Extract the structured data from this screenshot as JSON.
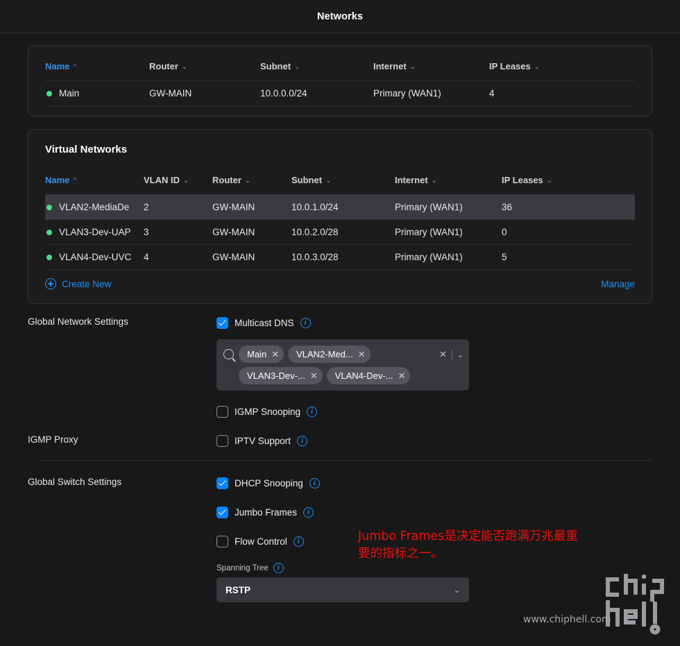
{
  "header": {
    "title": "Networks"
  },
  "networks_card": {
    "columns": [
      {
        "label": "Name",
        "sorted": true,
        "icon": "chevron-up-icon"
      },
      {
        "label": "Router",
        "sorted": false,
        "icon": "chevron-down-icon"
      },
      {
        "label": "Subnet",
        "sorted": false,
        "icon": "chevron-down-icon"
      },
      {
        "label": "Internet",
        "sorted": false,
        "icon": "chevron-down-icon"
      },
      {
        "label": "IP Leases",
        "sorted": false,
        "icon": "chevron-down-icon"
      }
    ],
    "rows": [
      {
        "status": "online",
        "name": "Main",
        "router": "GW-MAIN",
        "subnet": "10.0.0.0/24",
        "internet": "Primary (WAN1)",
        "leases": "4"
      }
    ]
  },
  "vlans_card": {
    "title": "Virtual Networks",
    "columns": [
      {
        "label": "Name",
        "sorted": true,
        "icon": "chevron-up-icon"
      },
      {
        "label": "VLAN ID",
        "sorted": false,
        "icon": "chevron-down-icon"
      },
      {
        "label": "Router",
        "sorted": false,
        "icon": "chevron-down-icon"
      },
      {
        "label": "Subnet",
        "sorted": false,
        "icon": "chevron-down-icon"
      },
      {
        "label": "Internet",
        "sorted": false,
        "icon": "chevron-down-icon"
      },
      {
        "label": "IP Leases",
        "sorted": false,
        "icon": "chevron-down-icon"
      }
    ],
    "rows": [
      {
        "status": "online",
        "name": "VLAN2-MediaDe",
        "vlan_id": "2",
        "router": "GW-MAIN",
        "subnet": "10.0.1.0/24",
        "internet": "Primary (WAN1)",
        "leases": "36",
        "selected": true
      },
      {
        "status": "online",
        "name": "VLAN3-Dev-UAP",
        "vlan_id": "3",
        "router": "GW-MAIN",
        "subnet": "10.0.2.0/28",
        "internet": "Primary (WAN1)",
        "leases": "0",
        "selected": false
      },
      {
        "status": "online",
        "name": "VLAN4-Dev-UVC",
        "vlan_id": "4",
        "router": "GW-MAIN",
        "subnet": "10.0.3.0/28",
        "internet": "Primary (WAN1)",
        "leases": "5",
        "selected": false
      }
    ],
    "create_new_label": "Create New",
    "manage_label": "Manage"
  },
  "settings": {
    "global_network_label": "Global Network Settings",
    "igmp_proxy_label": "IGMP Proxy",
    "global_switch_label": "Global Switch Settings",
    "multicast_dns": {
      "label": "Multicast DNS",
      "checked": true
    },
    "multiselect": {
      "search_placeholder": "",
      "chips": [
        {
          "label": "Main"
        },
        {
          "label": "VLAN2-Med..."
        },
        {
          "label": "VLAN3-Dev-..."
        },
        {
          "label": "VLAN4-Dev-..."
        }
      ],
      "clear_all": "×",
      "chevron": "⌄"
    },
    "igmp_snooping": {
      "label": "IGMP Snooping",
      "checked": false
    },
    "iptv_support": {
      "label": "IPTV Support",
      "checked": false
    },
    "dhcp_snooping": {
      "label": "DHCP Snooping",
      "checked": true
    },
    "jumbo_frames": {
      "label": "Jumbo Frames",
      "checked": true
    },
    "flow_control": {
      "label": "Flow Control",
      "checked": false
    },
    "spanning_tree": {
      "label": "Spanning Tree",
      "value": "RSTP"
    }
  },
  "annotation": {
    "text": "Jumbo Frames是决定能否跑满万兆最重要的指标之一。",
    "color": "#f20d0d"
  },
  "watermark": {
    "text": "www.chiphell.com",
    "logo": "chiphell"
  },
  "colors": {
    "page_bg": "#181818",
    "card_bg": "#1c1c1c",
    "accent_blue": "#1f8ff5",
    "checkbox_blue": "#0b84f3",
    "status_green": "#4ade8c",
    "selected_row": "#3a3a40",
    "input_bg": "#37373d"
  }
}
